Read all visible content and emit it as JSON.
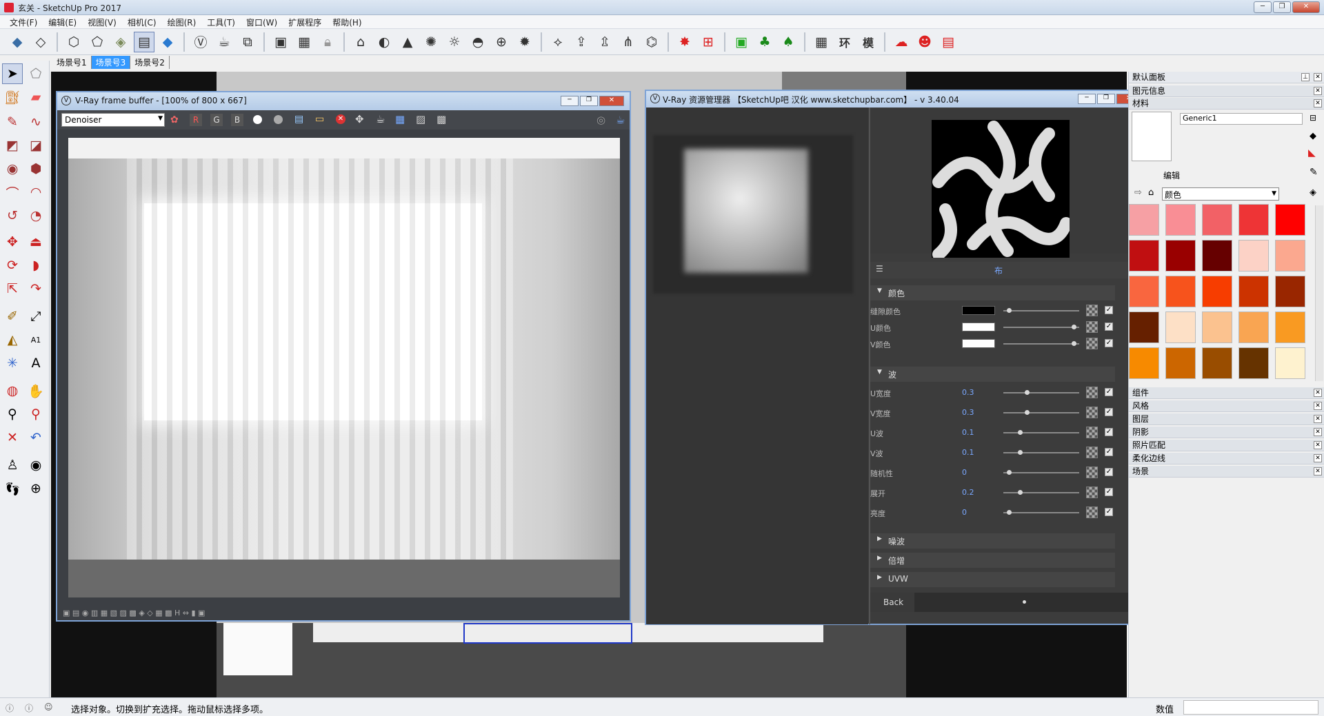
{
  "app": {
    "title": "玄关 - SketchUp Pro 2017"
  },
  "menu": [
    "文件(F)",
    "编辑(E)",
    "视图(V)",
    "相机(C)",
    "绘图(R)",
    "工具(T)",
    "窗口(W)",
    "扩展程序",
    "帮助(H)"
  ],
  "scenes": [
    {
      "label": "场景号1",
      "active": false
    },
    {
      "label": "场景号3",
      "active": true
    },
    {
      "label": "场景号2",
      "active": false
    }
  ],
  "toolbar_icons": [
    "box-icon",
    "rotate-box-icon",
    "cube-icon",
    "cube-outline-icon",
    "shaded-cube-icon",
    "stripe-cube-icon",
    "blue-cube-icon",
    "vray-logo-icon",
    "teapot-icon",
    "render-region-icon",
    "frame-icon",
    "frame2-icon",
    "lock-icon",
    "hat-icon",
    "sphere-icon",
    "lamp-icon",
    "sun-icon",
    "dome-icon",
    "globe-icon",
    "light-gen-icon",
    "plane-icon",
    "proxy-icon",
    "proxy2-icon",
    "fur-icon",
    "brush-icon",
    "gear-red-icon",
    "grid-red-icon",
    "photo-icon",
    "tree-icon",
    "tree2-icon",
    "table-icon",
    "环",
    "模",
    "cloud-icon",
    "people-icon",
    "doc-icon"
  ],
  "vfb": {
    "title": "V-Ray frame buffer - [100% of 800 x 667]",
    "channel": "Denoiser",
    "rgb": [
      "R",
      "G",
      "B"
    ]
  },
  "vra": {
    "title": "V-Ray 资源管理器 【SketchUp吧 汉化 www.sketchupbar.com】 - v 3.40.04",
    "tex_name": "布",
    "sections": {
      "color": "颜色",
      "wave": "波",
      "noise": "噪波",
      "multiply": "倍增",
      "uvw": "UVW"
    },
    "color_params": [
      {
        "name": "缝隙颜色",
        "color": "#000000",
        "knob": 0.05
      },
      {
        "name": "U颜色",
        "color": "#ffffff",
        "knob": 0.95
      },
      {
        "name": "V颜色",
        "color": "#ffffff",
        "knob": 0.95
      }
    ],
    "wave_params": [
      {
        "name": "U宽度",
        "value": "0.3",
        "knob": 0.3
      },
      {
        "name": "V宽度",
        "value": "0.3",
        "knob": 0.3
      },
      {
        "name": "U波",
        "value": "0.1",
        "knob": 0.2
      },
      {
        "name": "V波",
        "value": "0.1",
        "knob": 0.2
      },
      {
        "name": "随机性",
        "value": "0",
        "knob": 0.05
      },
      {
        "name": "展开",
        "value": "0.2",
        "knob": 0.2
      },
      {
        "name": "亮度",
        "value": "0",
        "knob": 0.05
      }
    ],
    "back": "Back"
  },
  "right_panel": {
    "title": "默认面板",
    "entity_info": "图元信息",
    "materials": "材料",
    "material_name": "Generic1",
    "edit_tab": "编辑",
    "library": "颜色",
    "swatches": [
      "#f6a0a4",
      "#f98e95",
      "#f26166",
      "#ee3436",
      "#ff0000",
      "#c00f11",
      "#990000",
      "#660000",
      "#fcd2c6",
      "#fba88f",
      "#f9663f",
      "#f7531c",
      "#f73d00",
      "#cc3300",
      "#992600",
      "#662000",
      "#fde0c6",
      "#fbc28f",
      "#f9a552",
      "#f99a22",
      "#f78a00",
      "#cc6600",
      "#994d00",
      "#663300",
      "#fef2cf"
    ],
    "panels": [
      "组件",
      "风格",
      "图层",
      "阴影",
      "照片匹配",
      "柔化边线",
      "场景"
    ]
  },
  "status": {
    "message": "选择对象。切换到扩充选择。拖动鼠标选择多项。",
    "value_label": "数值",
    "value": ""
  }
}
